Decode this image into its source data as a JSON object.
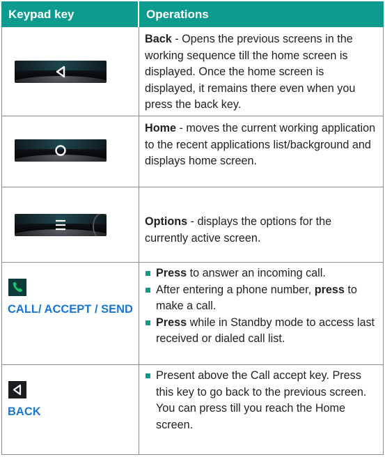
{
  "header": {
    "col1": "Keypad key",
    "col2": "Operations"
  },
  "rows": [
    {
      "icon": "back-key-bar-icon",
      "bold": "Back",
      "text": " - Opens the previous screens in the working sequence till the home screen is displayed. Once the home screen is displayed, it remains there even when you press the back key."
    },
    {
      "icon": "home-key-bar-icon",
      "bold": "Home",
      "text": " - moves the current working application to the recent applications list/background and displays home screen."
    },
    {
      "icon": "options-key-bar-icon",
      "bold": "Options",
      "text": " - displays the options for the currently active screen."
    },
    {
      "icon": "call-icon",
      "label": "CALL/ ACCEPT / SEND",
      "bullets": [
        {
          "pre": "",
          "bold": "Press",
          "post": " to answer an incoming call."
        },
        {
          "pre": "After entering a phone number, ",
          "bold": "press",
          "post": " to make a call."
        },
        {
          "pre": "",
          "bold": "Press",
          "post": " while in Standby mode to access last received or dialed call list."
        }
      ]
    },
    {
      "icon": "back-icon",
      "label": "BACK",
      "bullets": [
        {
          "pre": "Present above the Call accept key. Press this key to go back to the previous screen. You can press till you reach the Home screen.",
          "bold": "",
          "post": ""
        }
      ]
    }
  ]
}
